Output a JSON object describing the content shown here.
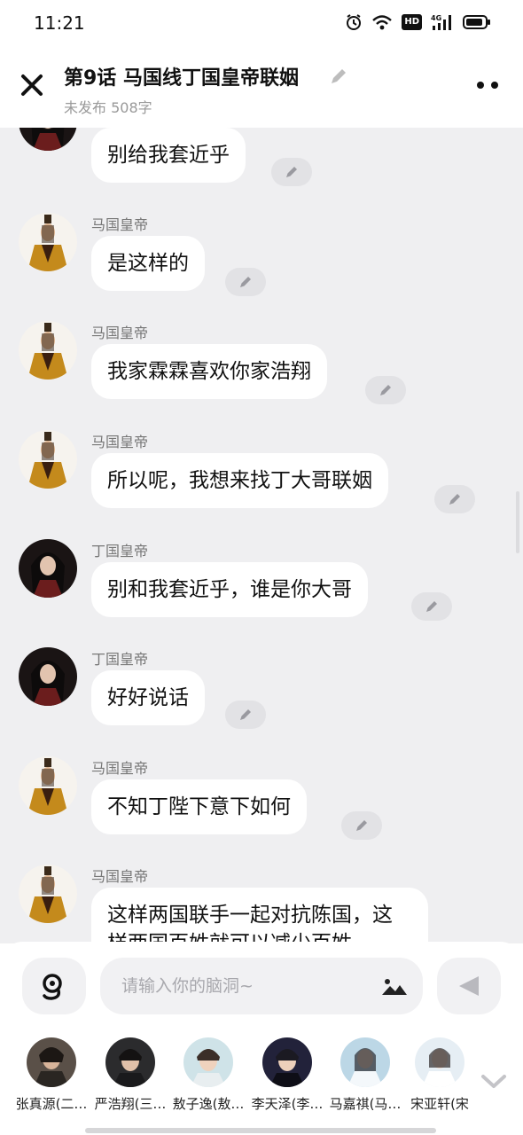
{
  "status_bar": {
    "time": "11:21",
    "icons": [
      "alarm-icon",
      "wifi-icon",
      "hd-icon",
      "4g-signal-icon",
      "battery-icon"
    ],
    "hd_label": "HD",
    "network_label": "4G"
  },
  "header": {
    "title": "第9话  马国线丁国皇帝联姻",
    "subtitle": "未发布 508字"
  },
  "messages": [
    {
      "sender": "",
      "text": "别给我套近乎",
      "avatar": "dark-haired-emperor"
    },
    {
      "sender": "马国皇帝",
      "text": "是这样的",
      "avatar": "gold-robe-emperor"
    },
    {
      "sender": "马国皇帝",
      "text": "我家霖霖喜欢你家浩翔",
      "avatar": "gold-robe-emperor"
    },
    {
      "sender": "马国皇帝",
      "text": "所以呢，我想来找丁大哥联姻",
      "avatar": "gold-robe-emperor"
    },
    {
      "sender": "丁国皇帝",
      "text": "别和我套近乎，谁是你大哥",
      "avatar": "dark-haired-emperor"
    },
    {
      "sender": "丁国皇帝",
      "text": "好好说话",
      "avatar": "dark-haired-emperor"
    },
    {
      "sender": "马国皇帝",
      "text": "不知丁陛下意下如何",
      "avatar": "gold-robe-emperor"
    },
    {
      "sender": "马国皇帝",
      "text": "这样两国联手一起对抗陈国，这样两国百姓就可以减少百姓",
      "avatar": "gold-robe-emperor"
    }
  ],
  "input": {
    "placeholder": "请输入你的脑洞~"
  },
  "characters": [
    {
      "name": "张真源(二…"
    },
    {
      "name": "严浩翔(三…"
    },
    {
      "name": "敖子逸(敖…"
    },
    {
      "name": "李天泽(李…"
    },
    {
      "name": "马嘉祺(马…"
    },
    {
      "name": "宋亚轩(宋"
    }
  ],
  "colors": {
    "chat_bg": "#efeff1",
    "bubble_bg": "#ffffff",
    "edit_chip_bg": "#e2e2e5",
    "panel_bg": "#ffffff",
    "input_bg": "#f1f1f3"
  }
}
